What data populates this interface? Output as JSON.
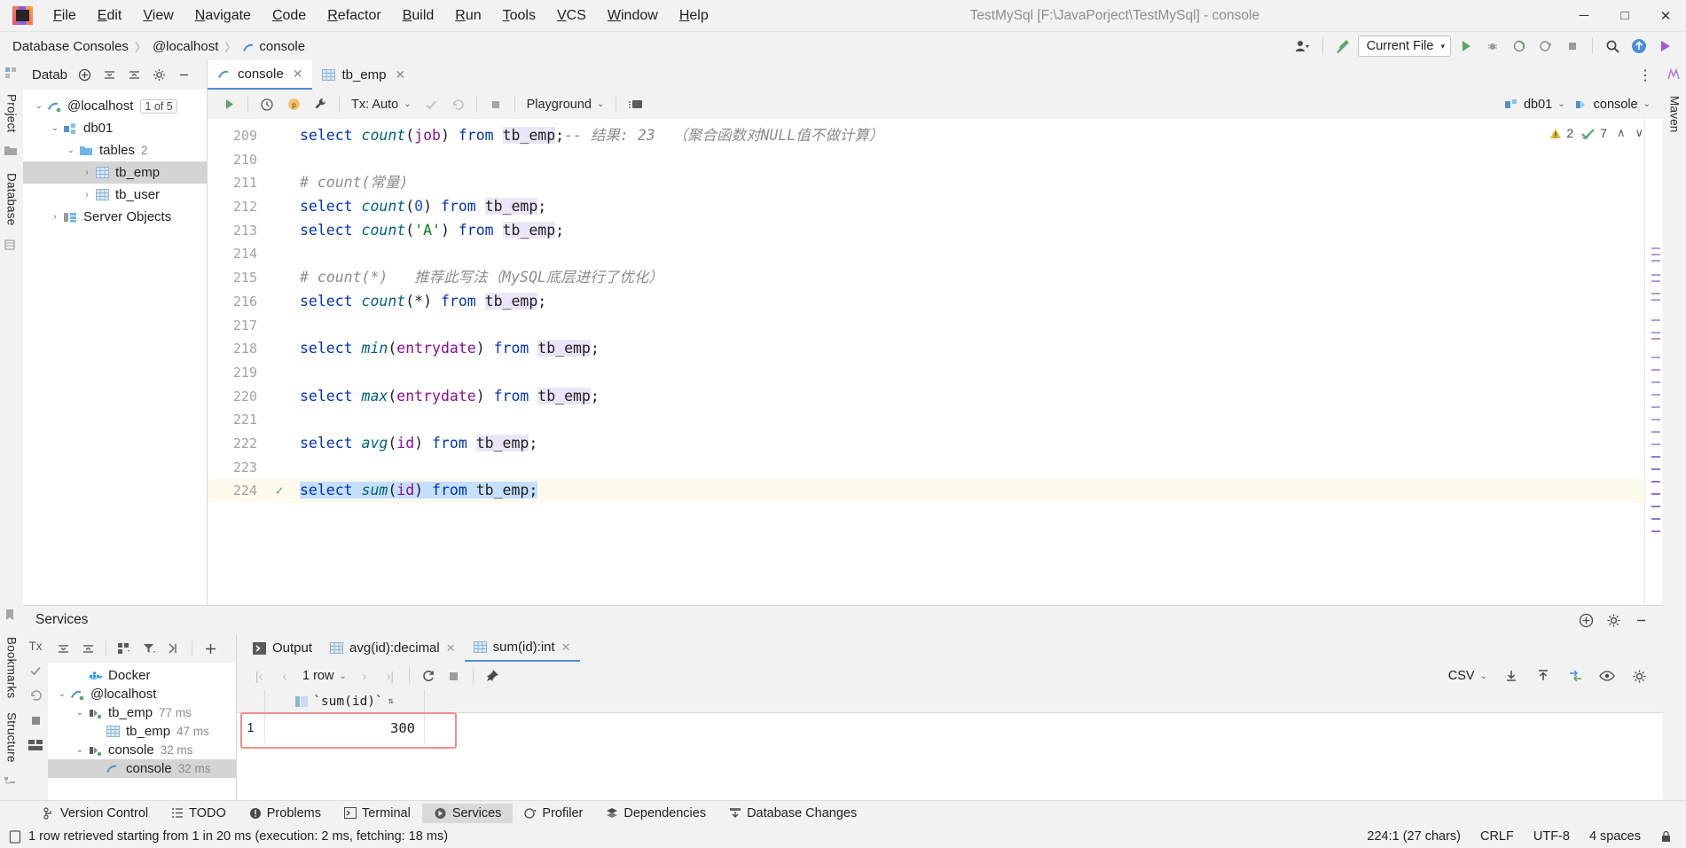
{
  "window": {
    "title": "TestMySql [F:\\JavaPorject\\TestMySql] - console",
    "minimize": "─",
    "maximize": "□",
    "close": "✕"
  },
  "menu": [
    "File",
    "Edit",
    "View",
    "Navigate",
    "Code",
    "Refactor",
    "Build",
    "Run",
    "Tools",
    "VCS",
    "Window",
    "Help"
  ],
  "breadcrumb": {
    "items": [
      "Database Consoles",
      "@localhost",
      "console"
    ],
    "separator": "〉"
  },
  "nav_right": {
    "run_config": "Current File",
    "caret": "▾"
  },
  "db_panel": {
    "title": "Datab",
    "tree": [
      {
        "label": "@localhost",
        "badge": "1 of 5",
        "indent": 0,
        "arrow": "⌄",
        "icon": "mysql-icon",
        "selected": false
      },
      {
        "label": "db01",
        "badge": "",
        "indent": 1,
        "arrow": "⌄",
        "icon": "schema-icon",
        "selected": false
      },
      {
        "label": "tables",
        "count": "2",
        "indent": 2,
        "arrow": "⌄",
        "icon": "folder-icon",
        "selected": false
      },
      {
        "label": "tb_emp",
        "indent": 3,
        "arrow": "›",
        "icon": "table-icon",
        "selected": true
      },
      {
        "label": "tb_user",
        "indent": 3,
        "arrow": "›",
        "icon": "table-icon",
        "selected": false
      },
      {
        "label": "Server Objects",
        "indent": 1,
        "arrow": "›",
        "icon": "server-objects-icon",
        "selected": false
      }
    ]
  },
  "editor": {
    "tabs": [
      {
        "label": "console",
        "icon": "console-icon",
        "active": true,
        "close": "✕"
      },
      {
        "label": "tb_emp",
        "icon": "table-icon",
        "active": false,
        "close": "✕"
      }
    ],
    "toolbar": {
      "tx_label": "Tx: Auto",
      "playground": "Playground",
      "caret": "⌄"
    },
    "session": {
      "schema": "db01",
      "console": "console"
    },
    "inspections": {
      "warning_count": "2",
      "check_count": "7",
      "up": "∧",
      "down": "∨"
    },
    "first_line_number": 209,
    "lines": [
      {
        "n": 209,
        "tokens": [
          {
            "t": "select",
            "c": "kw"
          },
          {
            "t": " ",
            "c": "punc"
          },
          {
            "t": "count",
            "c": "fn"
          },
          {
            "t": "(",
            "c": "punc"
          },
          {
            "t": "job",
            "c": "ident"
          },
          {
            "t": ") ",
            "c": "punc"
          },
          {
            "t": "from",
            "c": "kw"
          },
          {
            "t": " ",
            "c": "punc"
          },
          {
            "t": "tb_emp",
            "c": "tbl"
          },
          {
            "t": ";",
            "c": "punc"
          },
          {
            "t": "-- 结果: 23  （聚合函数对NULL值不做计算）",
            "c": "cmt"
          }
        ]
      },
      {
        "n": 210,
        "tokens": []
      },
      {
        "n": 211,
        "tokens": [
          {
            "t": "# count(常量)",
            "c": "cmt"
          }
        ]
      },
      {
        "n": 212,
        "tokens": [
          {
            "t": "select",
            "c": "kw"
          },
          {
            "t": " ",
            "c": "punc"
          },
          {
            "t": "count",
            "c": "fn"
          },
          {
            "t": "(",
            "c": "punc"
          },
          {
            "t": "0",
            "c": "num"
          },
          {
            "t": ") ",
            "c": "punc"
          },
          {
            "t": "from",
            "c": "kw"
          },
          {
            "t": " ",
            "c": "punc"
          },
          {
            "t": "tb_emp",
            "c": "tbl"
          },
          {
            "t": ";",
            "c": "punc"
          }
        ]
      },
      {
        "n": 213,
        "tokens": [
          {
            "t": "select",
            "c": "kw"
          },
          {
            "t": " ",
            "c": "punc"
          },
          {
            "t": "count",
            "c": "fn"
          },
          {
            "t": "(",
            "c": "punc"
          },
          {
            "t": "'A'",
            "c": "str"
          },
          {
            "t": ") ",
            "c": "punc"
          },
          {
            "t": "from",
            "c": "kw"
          },
          {
            "t": " ",
            "c": "punc"
          },
          {
            "t": "tb_emp",
            "c": "tbl"
          },
          {
            "t": ";",
            "c": "punc"
          }
        ]
      },
      {
        "n": 214,
        "tokens": []
      },
      {
        "n": 215,
        "tokens": [
          {
            "t": "# count(*)   推荐此写法（MySQL底层进行了优化）",
            "c": "cmt"
          }
        ]
      },
      {
        "n": 216,
        "tokens": [
          {
            "t": "select",
            "c": "kw"
          },
          {
            "t": " ",
            "c": "punc"
          },
          {
            "t": "count",
            "c": "fn"
          },
          {
            "t": "(",
            "c": "punc"
          },
          {
            "t": "*",
            "c": "punc"
          },
          {
            "t": ") ",
            "c": "punc"
          },
          {
            "t": "from",
            "c": "kw"
          },
          {
            "t": " ",
            "c": "punc"
          },
          {
            "t": "tb_emp",
            "c": "tbl"
          },
          {
            "t": ";",
            "c": "punc"
          }
        ]
      },
      {
        "n": 217,
        "tokens": []
      },
      {
        "n": 218,
        "tokens": [
          {
            "t": "select",
            "c": "kw"
          },
          {
            "t": " ",
            "c": "punc"
          },
          {
            "t": "min",
            "c": "fn"
          },
          {
            "t": "(",
            "c": "punc"
          },
          {
            "t": "entrydate",
            "c": "ident"
          },
          {
            "t": ") ",
            "c": "punc"
          },
          {
            "t": "from",
            "c": "kw"
          },
          {
            "t": " ",
            "c": "punc"
          },
          {
            "t": "tb_emp",
            "c": "tbl"
          },
          {
            "t": ";",
            "c": "punc"
          }
        ]
      },
      {
        "n": 219,
        "tokens": []
      },
      {
        "n": 220,
        "tokens": [
          {
            "t": "select",
            "c": "kw"
          },
          {
            "t": " ",
            "c": "punc"
          },
          {
            "t": "max",
            "c": "fn"
          },
          {
            "t": "(",
            "c": "punc"
          },
          {
            "t": "entrydate",
            "c": "ident"
          },
          {
            "t": ") ",
            "c": "punc"
          },
          {
            "t": "from",
            "c": "kw"
          },
          {
            "t": " ",
            "c": "punc"
          },
          {
            "t": "tb_emp",
            "c": "tbl"
          },
          {
            "t": ";",
            "c": "punc"
          }
        ]
      },
      {
        "n": 221,
        "tokens": []
      },
      {
        "n": 222,
        "tokens": [
          {
            "t": "select",
            "c": "kw"
          },
          {
            "t": " ",
            "c": "punc"
          },
          {
            "t": "avg",
            "c": "fn"
          },
          {
            "t": "(",
            "c": "punc"
          },
          {
            "t": "id",
            "c": "ident"
          },
          {
            "t": ") ",
            "c": "punc"
          },
          {
            "t": "from",
            "c": "kw"
          },
          {
            "t": " ",
            "c": "punc"
          },
          {
            "t": "tb_emp",
            "c": "tbl"
          },
          {
            "t": ";",
            "c": "punc"
          }
        ]
      },
      {
        "n": 223,
        "tokens": []
      },
      {
        "n": 224,
        "tokens": [
          {
            "t": "select",
            "c": "kw sel-txt"
          },
          {
            "t": " ",
            "c": "punc sel-txt"
          },
          {
            "t": "sum",
            "c": "fn sel-txt"
          },
          {
            "t": "(",
            "c": "punc sel-txt"
          },
          {
            "t": "id",
            "c": "ident sel-txt"
          },
          {
            "t": ") ",
            "c": "punc sel-txt"
          },
          {
            "t": "from",
            "c": "kw sel-txt"
          },
          {
            "t": " ",
            "c": "punc sel-txt"
          },
          {
            "t": "tb_emp",
            "c": "tbl sel-txt"
          },
          {
            "t": ";",
            "c": "punc sel-txt"
          }
        ],
        "gutter_mark": "✓",
        "current": true,
        "highlight": true
      }
    ]
  },
  "services": {
    "title": "Services",
    "tree": [
      {
        "label": "Docker",
        "indent": 1,
        "arrow": "",
        "icon": "docker-icon",
        "selected": false
      },
      {
        "label": "@localhost",
        "indent": 0,
        "arrow": "⌄",
        "icon": "mysql-icon",
        "selected": false
      },
      {
        "label": "tb_emp",
        "time": "77 ms",
        "indent": 1,
        "arrow": "⌄",
        "icon": "session-icon",
        "selected": false
      },
      {
        "label": "tb_emp",
        "time": "47 ms",
        "indent": 2,
        "arrow": "",
        "icon": "table-icon",
        "selected": false
      },
      {
        "label": "console",
        "time": "32 ms",
        "indent": 1,
        "arrow": "⌄",
        "icon": "session-icon",
        "selected": false
      },
      {
        "label": "console",
        "time": "32 ms",
        "indent": 2,
        "arrow": "",
        "icon": "console-icon",
        "selected": true
      }
    ],
    "tx_label": "Tx"
  },
  "results": {
    "tabs": [
      {
        "label": "Output",
        "icon": "output-icon",
        "active": false,
        "closable": false
      },
      {
        "label": "avg(id):decimal",
        "icon": "table-icon",
        "active": false,
        "closable": true,
        "close": "✕"
      },
      {
        "label": "sum(id):int",
        "icon": "table-icon",
        "active": true,
        "closable": true,
        "close": "✕"
      }
    ],
    "pager": {
      "first": "|‹",
      "prev": "‹",
      "rows": "1 row",
      "caret": "⌄",
      "next": "›",
      "last": "›|"
    },
    "export_format": "CSV",
    "grid": {
      "columns": [
        "`sum(id)`"
      ],
      "rows": [
        {
          "num": "1",
          "values": [
            "300"
          ]
        }
      ]
    }
  },
  "tool_windows": [
    {
      "label": "Version Control",
      "icon": "branch-icon",
      "active": false
    },
    {
      "label": "TODO",
      "icon": "todo-icon",
      "active": false
    },
    {
      "label": "Problems",
      "icon": "problems-icon",
      "active": false
    },
    {
      "label": "Terminal",
      "icon": "terminal-icon",
      "active": false
    },
    {
      "label": "Services",
      "icon": "services-icon",
      "active": true
    },
    {
      "label": "Profiler",
      "icon": "profiler-icon",
      "active": false
    },
    {
      "label": "Dependencies",
      "icon": "dependencies-icon",
      "active": false
    },
    {
      "label": "Database Changes",
      "icon": "db-changes-icon",
      "active": false
    }
  ],
  "left_rail": [
    "Project",
    "Database"
  ],
  "left_rail_bottom": [
    "Bookmarks",
    "Structure"
  ],
  "right_rail": [
    "Maven"
  ],
  "statusbar": {
    "message": "1 row retrieved starting from 1 in 20 ms (execution: 2 ms, fetching: 18 ms)",
    "caret_position": "224:1 (27 chars)",
    "line_separator": "CRLF",
    "encoding": "UTF-8",
    "indent": "4 spaces"
  },
  "colors": {
    "accent": "#4a90d9",
    "keyword": "#0033b3",
    "function": "#00627a",
    "identifier": "#871094",
    "string": "#067d17",
    "number": "#1750eb",
    "comment": "#8c8c8c",
    "selection": "#c5dffc",
    "table_highlight": "#eae6f8",
    "annotation_box": "#f08d8d",
    "warning": "#e8b931",
    "ok": "#59a869"
  }
}
